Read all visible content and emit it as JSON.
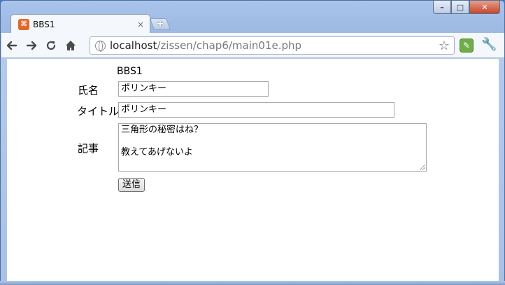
{
  "browser": {
    "tab_title": "BBS1",
    "tab_close": "×",
    "new_tab": "+",
    "favicon_text": "⌘",
    "url_host": "localhost",
    "url_path": "/zissen/chap6/main01e.php",
    "icons": [
      "back-icon",
      "forward-icon",
      "reload-icon",
      "home-icon",
      "globe-icon",
      "star-icon",
      "evernote-icon",
      "wrench-icon"
    ]
  },
  "window_controls": {
    "minimize": "–",
    "maximize": "□",
    "close": "✕"
  },
  "form": {
    "heading": "BBS1",
    "name_label": "氏名",
    "name_value": "ポリンキー",
    "title_label": "タイトル",
    "title_value": "ポリンキー",
    "body_label": "記事",
    "body_value": "三角形の秘密はね？\n\n教えてあげないよ",
    "submit_label": "送信"
  }
}
